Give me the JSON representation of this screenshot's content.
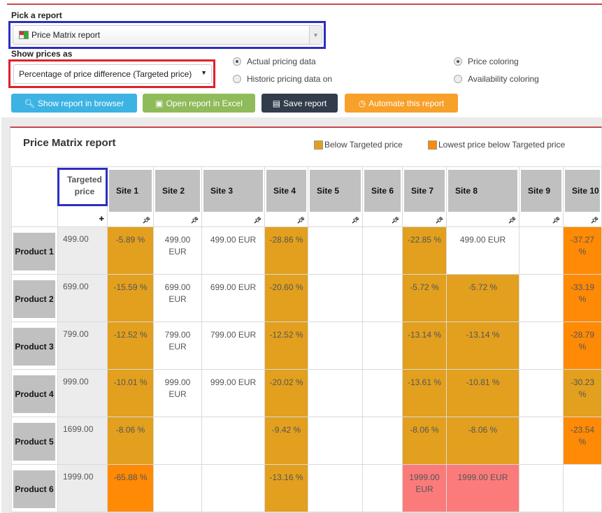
{
  "pick_label": "Pick a report",
  "report_select": {
    "value": "Price Matrix report"
  },
  "show_label": "Show prices as",
  "price_select": {
    "value": "Percentage of price difference (Targeted price)"
  },
  "radios": {
    "actual": "Actual pricing data",
    "historic": "Historic pricing data on",
    "price_coloring": "Price coloring",
    "availability_coloring": "Availability coloring"
  },
  "buttons": {
    "show": "Show report in browser",
    "excel": "Open report in Excel",
    "save": "Save report",
    "automate": "Automate this report"
  },
  "colors": {
    "blue_btn": "#3cb3e3",
    "green_btn": "#8fbb5a",
    "dark_btn": "#323c4a",
    "orange_btn": "#f7a02a",
    "below": "#e2a01e",
    "lowest": "#ff8a05",
    "pink": "#fb7b7b"
  },
  "report": {
    "title": "Price Matrix report",
    "legend_below": "Below Targeted price",
    "legend_lowest": "Lowest price below Targeted price",
    "targeted_header": "Targeted price",
    "sites": [
      "Site 1",
      "Site 2",
      "Site 3",
      "Site 4",
      "Site 5",
      "Site 6",
      "Site 7",
      "Site 8",
      "Site 9",
      "Site 10"
    ],
    "rows": [
      {
        "product": "Product 1",
        "tp": "499.00",
        "cells": [
          [
            "-5.89 %",
            "gold"
          ],
          [
            "499.00 EUR",
            ""
          ],
          [
            "499.00  EUR",
            ""
          ],
          [
            "-28.86 %",
            "gold"
          ],
          [
            "",
            ""
          ],
          [
            "",
            ""
          ],
          [
            "-22.85 %",
            "gold"
          ],
          [
            "499.00  EUR",
            ""
          ],
          [
            "",
            ""
          ],
          [
            "-37.27 %",
            "orange"
          ]
        ]
      },
      {
        "product": "Product 2",
        "tp": "699.00",
        "cells": [
          [
            "-15.59 %",
            "gold"
          ],
          [
            "699.00 EUR",
            ""
          ],
          [
            "699.00  EUR",
            ""
          ],
          [
            "-20.60 %",
            "gold"
          ],
          [
            "",
            ""
          ],
          [
            "",
            ""
          ],
          [
            "-5.72 %",
            "gold"
          ],
          [
            "-5.72 %",
            "gold"
          ],
          [
            "",
            ""
          ],
          [
            "-33.19 %",
            "orange"
          ]
        ]
      },
      {
        "product": "Product 3",
        "tp": "799.00",
        "cells": [
          [
            "-12.52 %",
            "gold"
          ],
          [
            "799.00 EUR",
            ""
          ],
          [
            "799.00  EUR",
            ""
          ],
          [
            "-12.52 %",
            "gold"
          ],
          [
            "",
            ""
          ],
          [
            "",
            ""
          ],
          [
            "-13.14 %",
            "gold"
          ],
          [
            "-13.14 %",
            "gold"
          ],
          [
            "",
            ""
          ],
          [
            "-28.79 %",
            "orange"
          ]
        ]
      },
      {
        "product": "Product 4",
        "tp": "999.00",
        "cells": [
          [
            "-10.01 %",
            "gold"
          ],
          [
            "999.00 EUR",
            ""
          ],
          [
            "999.00  EUR",
            ""
          ],
          [
            "-20.02 %",
            "gold"
          ],
          [
            "",
            ""
          ],
          [
            "",
            ""
          ],
          [
            "-13.61 %",
            "gold"
          ],
          [
            "-10.81 %",
            "gold"
          ],
          [
            "",
            ""
          ],
          [
            "-30.23 %",
            "gold"
          ]
        ]
      },
      {
        "product": "Product 5",
        "tp": "1699.00",
        "cells": [
          [
            "-8.06 %",
            "gold"
          ],
          [
            "",
            ""
          ],
          [
            "",
            ""
          ],
          [
            "-9.42 %",
            "gold"
          ],
          [
            "",
            ""
          ],
          [
            "",
            ""
          ],
          [
            "-8.06 %",
            "gold"
          ],
          [
            "-8.06 %",
            "gold"
          ],
          [
            "",
            ""
          ],
          [
            "-23.54 %",
            "orange"
          ]
        ]
      },
      {
        "product": "Product 6",
        "tp": "1999.00",
        "cells": [
          [
            "-65.88 %",
            "orange"
          ],
          [
            "",
            ""
          ],
          [
            "",
            ""
          ],
          [
            "-13.16 %",
            "gold"
          ],
          [
            "",
            ""
          ],
          [
            "",
            ""
          ],
          [
            "1999.00 EUR",
            "pink"
          ],
          [
            "1999.00  EUR",
            "pink"
          ],
          [
            "",
            ""
          ],
          [
            "",
            ""
          ]
        ]
      }
    ]
  }
}
